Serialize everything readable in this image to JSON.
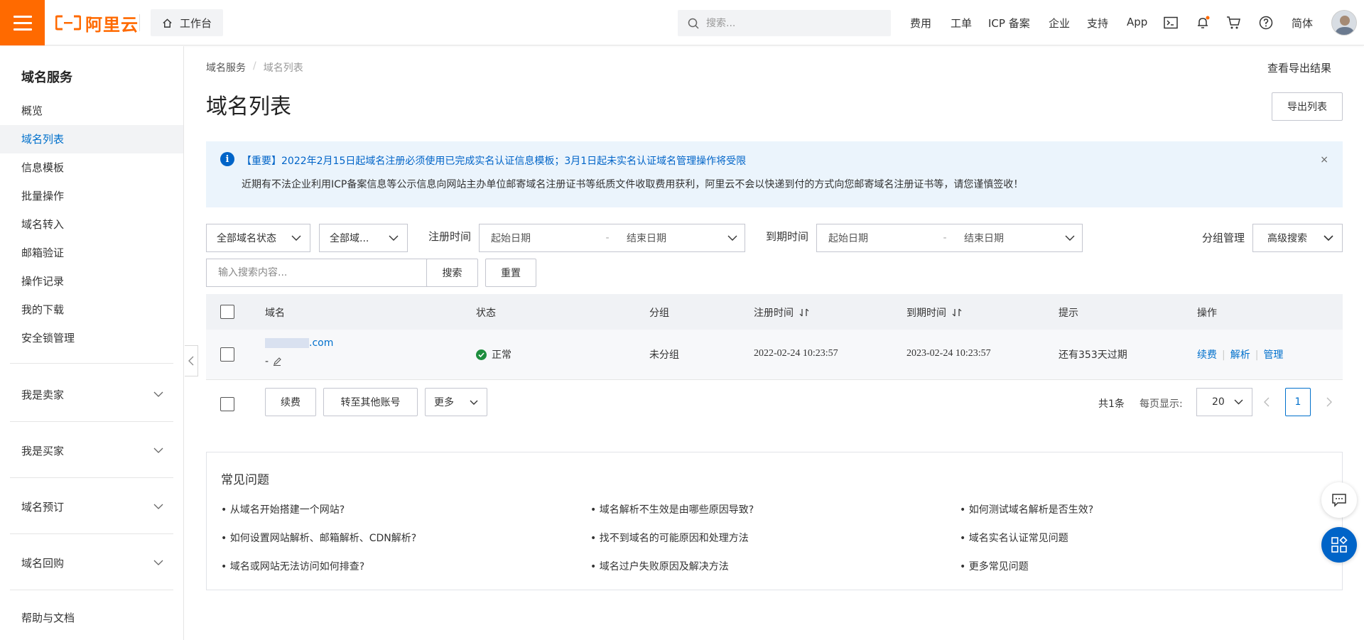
{
  "topbar": {
    "logo_text": "阿里云",
    "workbench_label": "工作台",
    "search_placeholder": "搜索...",
    "nav": [
      "费用",
      "工单",
      "ICP 备案",
      "企业",
      "支持",
      "App"
    ],
    "lang_label": "简体",
    "icons": [
      "terminal-icon",
      "bell-icon",
      "cart-icon",
      "help-icon"
    ],
    "accent_color": "#ff6a00"
  },
  "sidebar": {
    "title": "域名服务",
    "items": [
      {
        "label": "概览"
      },
      {
        "label": "域名列表"
      },
      {
        "label": "信息模板"
      },
      {
        "label": "批量操作"
      },
      {
        "label": "域名转入"
      },
      {
        "label": "邮箱验证"
      },
      {
        "label": "操作记录"
      },
      {
        "label": "我的下载"
      },
      {
        "label": "安全锁管理"
      }
    ],
    "groups": [
      {
        "label": "我是卖家"
      },
      {
        "label": "我是买家"
      },
      {
        "label": "域名预订"
      },
      {
        "label": "域名回购"
      }
    ],
    "footer_label": "帮助与文档"
  },
  "main": {
    "breadcrumb": [
      "域名服务",
      "/",
      "域名列表"
    ],
    "export_result_link": "查看导出结果",
    "title": "域名列表",
    "export_button": "导出列表",
    "notice": {
      "line1": "【重要】2022年2月15日起域名注册必须使用已完成实名认证信息模板；3月1日起未实名认证域名管理操作将受限",
      "line2": "近期有不法企业利用ICP备案信息等公示信息向网站主办单位邮寄域名注册证书等纸质文件收取费用获利，阿里云不会以快递到付的方式向您邮寄域名注册证书等，请您谨慎签收！",
      "close": "×"
    },
    "filters": {
      "status_select": "全部域名状态",
      "domain_select": "全部域...",
      "reg_time_label": "注册时间",
      "exp_time_label": "到期时间",
      "start_placeholder": "起始日期",
      "end_placeholder": "结束日期",
      "dash": "-",
      "group_manage": "分组管理",
      "advanced_search": "高级搜索",
      "search_placeholder": "输入搜索内容...",
      "search_button": "搜索",
      "reset_button": "重置"
    },
    "table": {
      "headers": [
        "域名",
        "状态",
        "分组",
        "注册时间",
        "到期时间",
        "提示",
        "操作"
      ],
      "rows": [
        {
          "domain_suffix": ".com",
          "sub": "-",
          "status": "正常",
          "group": "未分组",
          "reg_time": "2022-02-24 10:23:57",
          "exp_time": "2023-02-24 10:23:57",
          "hint": "还有353天过期",
          "actions": [
            "续费",
            "解析",
            "管理"
          ]
        }
      ]
    },
    "bulk": {
      "renew": "续费",
      "transfer": "转至其他账号",
      "more": "更多"
    },
    "pagination": {
      "total": "共1条",
      "per_page_label": "每页显示:",
      "per_page": "20",
      "current_page": "1"
    },
    "faq": {
      "title": "常见问题",
      "items": [
        "• 从域名开始搭建一个网站?",
        "• 域名解析不生效是由哪些原因导致?",
        "• 如何测试域名解析是否生效?",
        "• 如何设置网站解析、邮箱解析、CDN解析?",
        "• 找不到域名的可能原因和处理方法",
        "• 域名实名认证常见问题",
        "• 域名或网站无法访问如何排查?",
        "• 域名过户失败原因及解决方法",
        "• 更多常见问题"
      ]
    }
  }
}
